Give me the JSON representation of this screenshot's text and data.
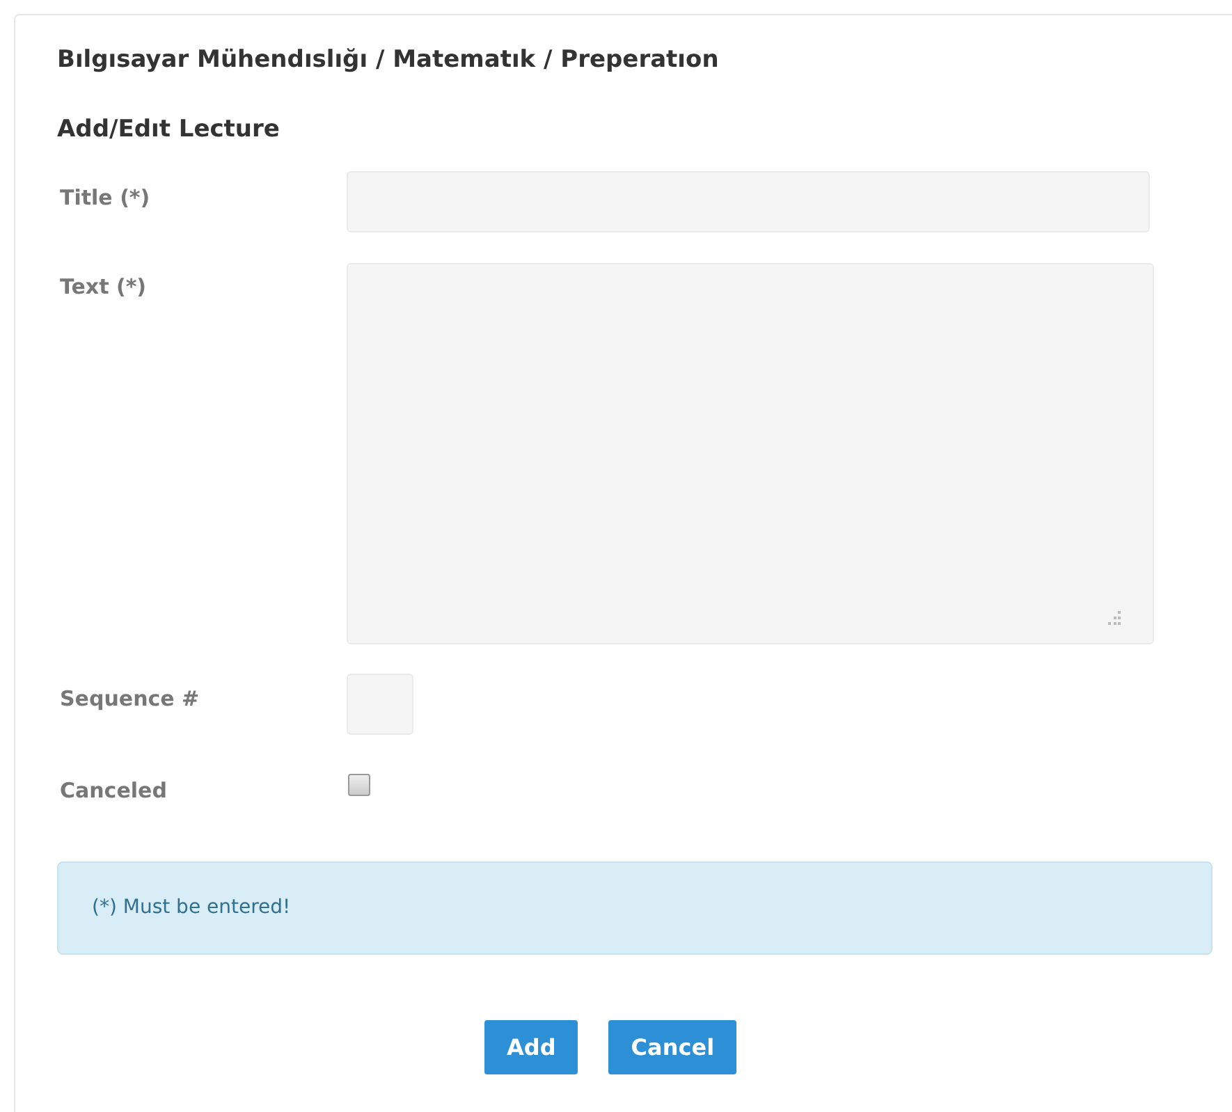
{
  "breadcrumb": "Bılgısayar Mühendıslığı / Matematık / Preperatıon",
  "form_title": "Add/Edıt Lecture",
  "fields": [
    {
      "kind": "text",
      "label": "Title (*)"
    },
    {
      "kind": "textarea",
      "label": "Text (*)"
    },
    {
      "kind": "number",
      "label": "Sequence #"
    },
    {
      "kind": "checkbox",
      "label": "Canceled",
      "checked": false
    }
  ],
  "notice": "(*) Must be entered!",
  "buttons": [
    "Add",
    "Cancel"
  ]
}
